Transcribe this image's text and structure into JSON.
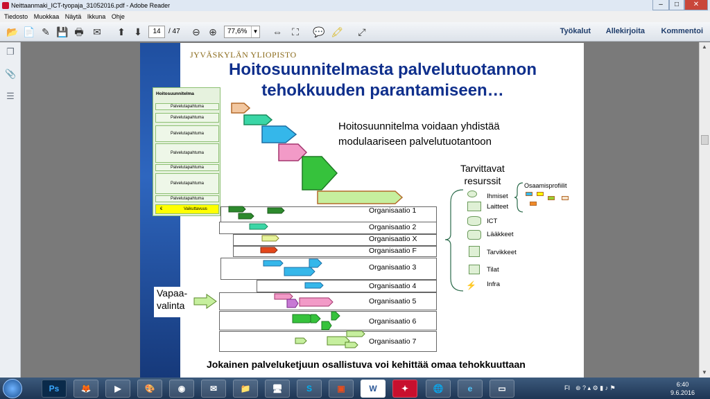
{
  "window": {
    "title": "Neittaanmaki_ICT-tyopaja_31052016.pdf - Adobe Reader",
    "minimize": "–",
    "maximize": "□",
    "close": "✕"
  },
  "menu": [
    "Tiedosto",
    "Muokkaa",
    "Näytä",
    "Ikkuna",
    "Ohje"
  ],
  "toolbar": {
    "page_current": "14",
    "page_total": "/ 47",
    "zoom": "77,6%",
    "right_links": [
      "Työkalut",
      "Allekirjoita",
      "Kommentoi"
    ]
  },
  "slide": {
    "university": "JYVÄSKYLÄN YLIOPISTO",
    "title_line1": "Hoitosuunnitelmasta  palvelutuotannon",
    "title_line2": "tehokkuuden parantamiseen…",
    "subtext_line1": "Hoitosuunnitelma voidaan yhdistää",
    "subtext_line2": "modulaariseen palvelutuotantoon",
    "resources_title_line1": "Tarvittavat",
    "resources_title_line2": "resurssit",
    "skill_profiles": "Osaamisprofiilit",
    "resources": [
      "Ihmiset",
      "Laitteet",
      "ICT",
      "Lääkkeet",
      "Tarvikkeet",
      "Tilat",
      "Infra"
    ],
    "care_plan_table": {
      "header": "Hoitosuunnitelma",
      "rows": [
        "Palvelutapahtuma",
        "Palvelutapahtuma",
        "Palvelutapahtuma",
        "Palvelutapahtuma",
        "Palvelutapahtuma",
        "Palvelutapahtuma",
        "Palvelutapahtuma"
      ],
      "footer_left": "€",
      "footer_right": "Vaikuttavuus"
    },
    "organisations": [
      "Organisaatio 1",
      "Organisaatio 2",
      "Organisaatio X",
      "Organisaatio F",
      "Organisaatio 3",
      "Organisaatio 4",
      "Organisaatio 5",
      "Organisaatio 6",
      "Organisaatio 7"
    ],
    "free_choice_line1": "Vapaa-",
    "free_choice_line2": "valinta",
    "footer": "Jokainen palveluketjuun osallistuva voi kehittää omaa tehokkuuttaan"
  },
  "taskbar": {
    "apps": [
      "start-orb",
      "photoshop",
      "firefox",
      "media-player",
      "paint",
      "chrome",
      "outlook",
      "file-explorer",
      "remote",
      "skype",
      "office",
      "word",
      "acrobat",
      "network",
      "internet-explorer",
      "screen"
    ],
    "icon_labels": {
      "photoshop": "Ps",
      "word": "W"
    },
    "language": "FI",
    "time": "6:40",
    "date": "9.6.2016"
  },
  "colors": {
    "title_blue": "#0f2f8c",
    "arrow_orange": "#f2c7a0",
    "arrow_teal": "#3ad6a6",
    "arrow_blue": "#35b7ea",
    "arrow_pink": "#f29ac7",
    "arrow_green": "#36c23c",
    "arrow_lightgreen": "#c6ef9e",
    "highlight_yellow": "#ffff00"
  }
}
